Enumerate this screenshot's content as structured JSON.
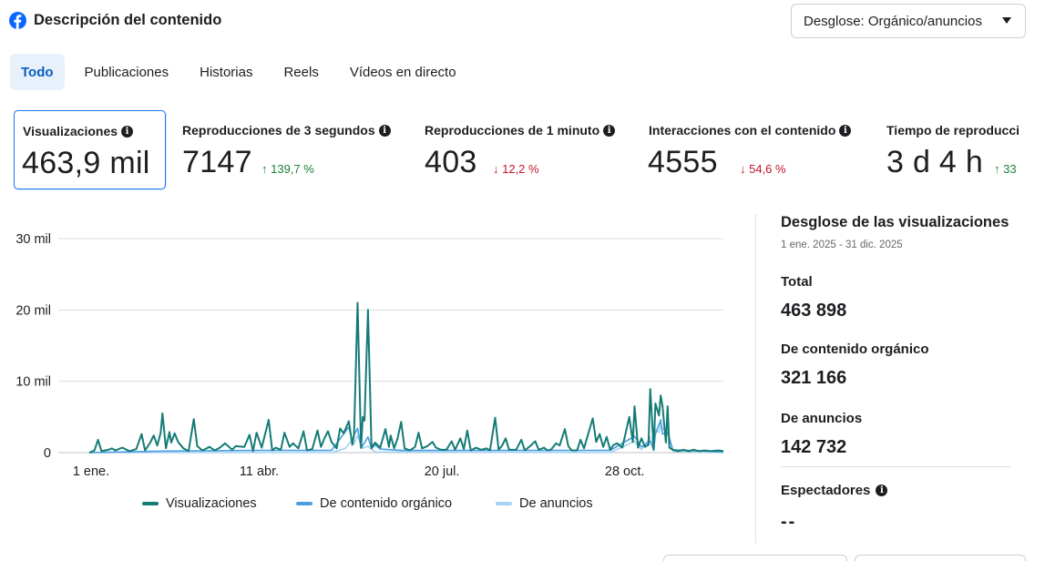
{
  "header": {
    "title": "Descripción del contenido"
  },
  "breakdown_dropdown": {
    "label": "Desglose: Orgánico/anuncios"
  },
  "tabs": [
    {
      "label": "Todo",
      "active": true
    },
    {
      "label": "Publicaciones",
      "active": false
    },
    {
      "label": "Historias",
      "active": false
    },
    {
      "label": "Reels",
      "active": false
    },
    {
      "label": "Vídeos en directo",
      "active": false
    }
  ],
  "metrics": [
    {
      "label": "Visualizaciones",
      "value": "463,9 mil",
      "delta": "",
      "selected": true
    },
    {
      "label": "Reproducciones de 3 segundos",
      "value": "7147",
      "delta": "↑ 139,7 %",
      "direction": "up"
    },
    {
      "label": "Reproducciones de 1 minuto",
      "value": "403",
      "delta": "↓ 12,2 %",
      "direction": "down"
    },
    {
      "label": "Interacciones con el contenido",
      "value": "4555",
      "delta": "↓ 54,6 %",
      "direction": "down"
    },
    {
      "label": "Tiempo de reproducci",
      "value": "3 d 4 h",
      "delta": "↑ 33",
      "direction": "up"
    }
  ],
  "chart_data": {
    "type": "line",
    "y_ticks": [
      "30 mil",
      "20 mil",
      "10 mil",
      "0"
    ],
    "y_tick_values": [
      30000,
      20000,
      10000,
      0
    ],
    "ylim": [
      0,
      30000
    ],
    "x_ticks": [
      "1 ene.",
      "11 abr.",
      "20 jul.",
      "28 oct."
    ],
    "x_tick_days": [
      1,
      101,
      201,
      301
    ],
    "xlim": [
      1,
      365
    ],
    "grid": true,
    "legend_position": "bottom",
    "series": [
      {
        "name": "Visualizaciones",
        "color": "#147b75",
        "points": [
          [
            1,
            0
          ],
          [
            4,
            300
          ],
          [
            6,
            1800
          ],
          [
            8,
            200
          ],
          [
            12,
            400
          ],
          [
            14,
            600
          ],
          [
            16,
            300
          ],
          [
            20,
            700
          ],
          [
            24,
            200
          ],
          [
            28,
            500
          ],
          [
            31,
            2600
          ],
          [
            33,
            300
          ],
          [
            36,
            1400
          ],
          [
            38,
            2400
          ],
          [
            40,
            1000
          ],
          [
            42,
            2800
          ],
          [
            43,
            5500
          ],
          [
            45,
            600
          ],
          [
            47,
            2900
          ],
          [
            48,
            1400
          ],
          [
            50,
            2700
          ],
          [
            52,
            1500
          ],
          [
            55,
            600
          ],
          [
            58,
            200
          ],
          [
            61,
            4700
          ],
          [
            63,
            900
          ],
          [
            66,
            300
          ],
          [
            70,
            800
          ],
          [
            73,
            300
          ],
          [
            76,
            700
          ],
          [
            79,
            1300
          ],
          [
            83,
            400
          ],
          [
            85,
            900
          ],
          [
            90,
            800
          ],
          [
            93,
            2500
          ],
          [
            95,
            200
          ],
          [
            97,
            2800
          ],
          [
            100,
            700
          ],
          [
            104,
            4600
          ],
          [
            106,
            300
          ],
          [
            108,
            700
          ],
          [
            111,
            400
          ],
          [
            113,
            2800
          ],
          [
            116,
            800
          ],
          [
            118,
            1300
          ],
          [
            121,
            600
          ],
          [
            124,
            3000
          ],
          [
            126,
            300
          ],
          [
            129,
            500
          ],
          [
            132,
            3100
          ],
          [
            134,
            800
          ],
          [
            136,
            2000
          ],
          [
            138,
            3000
          ],
          [
            140,
            1500
          ],
          [
            143,
            600
          ],
          [
            145,
            3400
          ],
          [
            147,
            2700
          ],
          [
            150,
            4400
          ],
          [
            152,
            1100
          ],
          [
            153,
            2500
          ],
          [
            155,
            21000
          ],
          [
            157,
            700
          ],
          [
            158,
            5000
          ],
          [
            159,
            4500
          ],
          [
            161,
            20000
          ],
          [
            163,
            600
          ],
          [
            165,
            1400
          ],
          [
            168,
            700
          ],
          [
            171,
            3300
          ],
          [
            173,
            800
          ],
          [
            174,
            2400
          ],
          [
            176,
            600
          ],
          [
            178,
            2000
          ],
          [
            180,
            4300
          ],
          [
            182,
            600
          ],
          [
            185,
            300
          ],
          [
            188,
            800
          ],
          [
            190,
            2800
          ],
          [
            192,
            600
          ],
          [
            195,
            900
          ],
          [
            198,
            1500
          ],
          [
            200,
            700
          ],
          [
            203,
            400
          ],
          [
            206,
            400
          ],
          [
            209,
            1600
          ],
          [
            211,
            400
          ],
          [
            214,
            2000
          ],
          [
            216,
            500
          ],
          [
            218,
            3100
          ],
          [
            220,
            300
          ],
          [
            223,
            700
          ],
          [
            226,
            400
          ],
          [
            229,
            600
          ],
          [
            231,
            300
          ],
          [
            234,
            4900
          ],
          [
            236,
            400
          ],
          [
            238,
            1000
          ],
          [
            240,
            2000
          ],
          [
            242,
            400
          ],
          [
            246,
            400
          ],
          [
            249,
            1800
          ],
          [
            251,
            300
          ],
          [
            254,
            900
          ],
          [
            257,
            1600
          ],
          [
            259,
            400
          ],
          [
            262,
            700
          ],
          [
            264,
            300
          ],
          [
            266,
            400
          ],
          [
            269,
            1300
          ],
          [
            271,
            1000
          ],
          [
            274,
            3300
          ],
          [
            276,
            900
          ],
          [
            278,
            300
          ],
          [
            281,
            300
          ],
          [
            283,
            1800
          ],
          [
            285,
            600
          ],
          [
            290,
            4800
          ],
          [
            292,
            1500
          ],
          [
            294,
            2600
          ],
          [
            296,
            800
          ],
          [
            298,
            2200
          ],
          [
            300,
            400
          ],
          [
            302,
            1100
          ],
          [
            304,
            1300
          ],
          [
            307,
            700
          ],
          [
            311,
            5000
          ],
          [
            313,
            1500
          ],
          [
            314,
            6500
          ],
          [
            316,
            700
          ],
          [
            318,
            2000
          ],
          [
            320,
            800
          ],
          [
            322,
            1100
          ],
          [
            323,
            8900
          ],
          [
            324,
            4900
          ],
          [
            325,
            400
          ],
          [
            326,
            6900
          ],
          [
            328,
            5200
          ],
          [
            329,
            8000
          ],
          [
            330,
            6600
          ],
          [
            332,
            1400
          ],
          [
            333,
            6500
          ],
          [
            334,
            700
          ],
          [
            336,
            400
          ],
          [
            339,
            200
          ],
          [
            342,
            400
          ],
          [
            345,
            200
          ],
          [
            348,
            400
          ],
          [
            351,
            200
          ],
          [
            354,
            300
          ],
          [
            358,
            200
          ],
          [
            362,
            300
          ],
          [
            365,
            200
          ]
        ]
      },
      {
        "name": "De contenido orgánico",
        "color": "#4a9fe0",
        "points": [
          [
            1,
            0
          ],
          [
            40,
            200
          ],
          [
            100,
            300
          ],
          [
            140,
            300
          ],
          [
            150,
            3600
          ],
          [
            152,
            1500
          ],
          [
            153,
            2500
          ],
          [
            155,
            3400
          ],
          [
            157,
            600
          ],
          [
            158,
            1000
          ],
          [
            161,
            2200
          ],
          [
            163,
            600
          ],
          [
            165,
            1100
          ],
          [
            168,
            500
          ],
          [
            180,
            300
          ],
          [
            200,
            300
          ],
          [
            260,
            300
          ],
          [
            300,
            300
          ],
          [
            314,
            2300
          ],
          [
            318,
            800
          ],
          [
            323,
            1600
          ],
          [
            325,
            400
          ],
          [
            326,
            2600
          ],
          [
            329,
            4600
          ],
          [
            330,
            2600
          ],
          [
            333,
            2800
          ],
          [
            336,
            400
          ],
          [
            365,
            100
          ]
        ]
      },
      {
        "name": "De anuncios",
        "color": "#a6d3f6",
        "points": [
          [
            1,
            0
          ],
          [
            140,
            0
          ],
          [
            148,
            600
          ],
          [
            152,
            1800
          ],
          [
            153,
            1200
          ],
          [
            155,
            2400
          ],
          [
            158,
            600
          ],
          [
            161,
            900
          ],
          [
            165,
            100
          ],
          [
            300,
            0
          ],
          [
            314,
            1600
          ],
          [
            318,
            400
          ],
          [
            323,
            2200
          ],
          [
            325,
            300
          ],
          [
            326,
            3300
          ],
          [
            328,
            2800
          ],
          [
            329,
            4200
          ],
          [
            330,
            3400
          ],
          [
            333,
            3000
          ],
          [
            336,
            200
          ],
          [
            365,
            0
          ]
        ]
      }
    ]
  },
  "side_panel": {
    "title": "Desglose de las visualizaciones",
    "date_range": "1 ene. 2025 - 31 dic. 2025",
    "total_label": "Total",
    "total_value": "463 898",
    "organic_label": "De contenido orgánico",
    "organic_value": "321 166",
    "ads_label": "De anuncios",
    "ads_value": "142 732",
    "viewers_label": "Espectadores",
    "viewers_value": "--"
  }
}
